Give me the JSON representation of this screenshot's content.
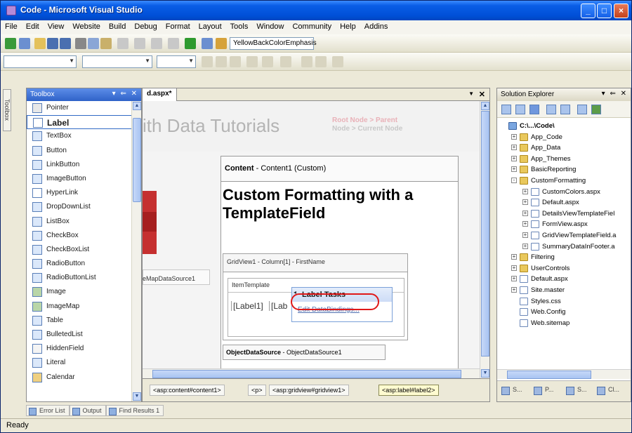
{
  "window": {
    "title": "Code - Microsoft Visual Studio"
  },
  "menu": [
    "File",
    "Edit",
    "View",
    "Website",
    "Build",
    "Debug",
    "Format",
    "Layout",
    "Tools",
    "Window",
    "Community",
    "Help",
    "Addins"
  ],
  "toolbar": {
    "css_class_combo": "YellowBackColorEmphasis"
  },
  "toolbox": {
    "title": "Toolbox",
    "items": [
      "Pointer",
      "Label",
      "TextBox",
      "Button",
      "LinkButton",
      "ImageButton",
      "HyperLink",
      "DropDownList",
      "ListBox",
      "CheckBox",
      "CheckBoxList",
      "RadioButton",
      "RadioButtonList",
      "Image",
      "ImageMap",
      "Table",
      "BulletedList",
      "HiddenField",
      "Literal",
      "Calendar"
    ],
    "selected_index": 1
  },
  "document": {
    "tab": "d.aspx*",
    "site_title": "ith Data Tutorials",
    "breadcrumb_line1": "Root Node > Parent",
    "breadcrumb_line2": "Node > Current Node",
    "left_label": "eMapDataSource1",
    "content_label": "Content",
    "content_sub": " - Content1 (Custom)",
    "page_heading": "Custom Formatting with a TemplateField",
    "gridview_header": "GridView1 - Column[1] - FirstName",
    "itemtemplate_header": "ItemTemplate",
    "label1": "[Label1]",
    "label2": "[Lab",
    "ods_label": "ObjectDataSource",
    "ods_sub": " - ObjectDataSource1",
    "smart_tag": {
      "title": "Label Tasks",
      "action": "Edit DataBindings..."
    }
  },
  "tag_navigator": [
    "<asp:content#content1>",
    "<p>",
    "<asp:gridview#gridview1>",
    "<asp:label#label2>"
  ],
  "bottom_tabs": [
    "Error List",
    "Output",
    "Find Results 1"
  ],
  "solution_explorer": {
    "title": "Solution Explorer",
    "tree": [
      {
        "name": "C:\\...\\Code\\",
        "indent": 0,
        "type": "root",
        "pm": ""
      },
      {
        "name": "App_Code",
        "indent": 1,
        "type": "folder",
        "pm": "+"
      },
      {
        "name": "App_Data",
        "indent": 1,
        "type": "folder",
        "pm": "+"
      },
      {
        "name": "App_Themes",
        "indent": 1,
        "type": "folder",
        "pm": "+"
      },
      {
        "name": "BasicReporting",
        "indent": 1,
        "type": "folder",
        "pm": "+"
      },
      {
        "name": "CustomFormatting",
        "indent": 1,
        "type": "folder",
        "pm": "-"
      },
      {
        "name": "CustomColors.aspx",
        "indent": 2,
        "type": "file",
        "pm": "+"
      },
      {
        "name": "Default.aspx",
        "indent": 2,
        "type": "file",
        "pm": "+"
      },
      {
        "name": "DetailsViewTemplateFiel",
        "indent": 2,
        "type": "file",
        "pm": "+"
      },
      {
        "name": "FormView.aspx",
        "indent": 2,
        "type": "file",
        "pm": "+"
      },
      {
        "name": "GridViewTemplateField.a",
        "indent": 2,
        "type": "file",
        "pm": "+"
      },
      {
        "name": "SummaryDataInFooter.a",
        "indent": 2,
        "type": "file",
        "pm": "+"
      },
      {
        "name": "Filtering",
        "indent": 1,
        "type": "folder",
        "pm": "+"
      },
      {
        "name": "UserControls",
        "indent": 1,
        "type": "folder",
        "pm": "+"
      },
      {
        "name": "Default.aspx",
        "indent": 1,
        "type": "file",
        "pm": "+"
      },
      {
        "name": "Site.master",
        "indent": 1,
        "type": "file",
        "pm": "+"
      },
      {
        "name": "Styles.css",
        "indent": 1,
        "type": "file",
        "pm": ""
      },
      {
        "name": "Web.Config",
        "indent": 1,
        "type": "file",
        "pm": ""
      },
      {
        "name": "Web.sitemap",
        "indent": 1,
        "type": "file",
        "pm": ""
      }
    ],
    "bottom_tabs": [
      "S...",
      "P...",
      "S...",
      "Cl..."
    ]
  },
  "status": "Ready",
  "colors": {
    "titlebar": "#0050d8",
    "highlight": "#e01818",
    "breadcrumb": "#e9b1b8",
    "red_block": "#c53030"
  }
}
